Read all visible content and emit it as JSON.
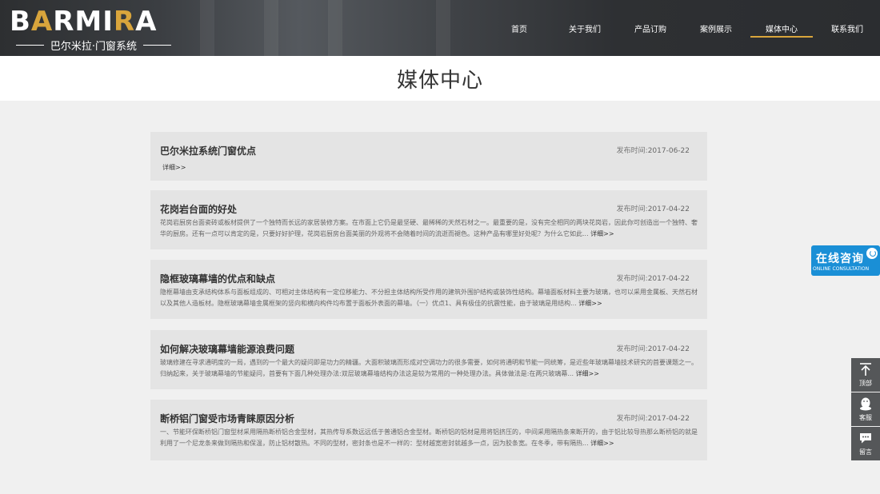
{
  "brand": {
    "logo_text_1": "B",
    "logo_accent_1": "A",
    "logo_text_2": "RMI",
    "logo_accent_2": "R",
    "logo_text_3": "A",
    "tagline": "巴尔米拉·门窗系统"
  },
  "nav": {
    "items": [
      {
        "label": "首页",
        "active": false
      },
      {
        "label": "关于我们",
        "active": false
      },
      {
        "label": "产品订购",
        "active": false
      },
      {
        "label": "案例展示",
        "active": false
      },
      {
        "label": "媒体中心",
        "active": true
      },
      {
        "label": "联系我们",
        "active": false
      }
    ]
  },
  "page_title": "媒体中心",
  "date_label": "发布时间:",
  "more_label": "详细>>",
  "articles": [
    {
      "title": "巴尔米拉系统门窗优点",
      "date": "2017-06-22",
      "excerpt": ""
    },
    {
      "title": "花岗岩台面的好处",
      "date": "2017-04-22",
      "excerpt": "花岗岩厨房台面瓷砖或板材提供了一个独特而长远的家居装修方案。在市面上它仍是最坚硬、最稀稀的天然石材之一。最重要的是，没有完全相同的两块花岗岩，因此你可创造出一个独特、奢华的厨房。还有一点可以肯定的是，只要好好护理，花岗岩厨房台面美丽的外观将不会随着时间的流逝而褪色。这种产品有哪里好处呢？为什么它如此..."
    },
    {
      "title": "隐框玻璃幕墙的优点和缺点",
      "date": "2017-04-22",
      "excerpt": "隐框幕墙由支承结构体系与面板组成的、可相对主体结构有一定位移能力、不分担主体结构所受作用的建筑外围护结构或装饰性结构。幕墙面板材料主要为玻璃，也可以采用金属板、天然石材以及其他人造板材。隐框玻璃幕墙金属框架的竖向和横向构件均布置于面板外表面的幕墙。（一）优点1、具有极佳的抗震性能，由于玻璃是用结构..."
    },
    {
      "title": "如何解决玻璃幕墙能源浪费问题",
      "date": "2017-04-22",
      "excerpt": "玻璃修建在寻求通明度的一局，遇到的一个最大的疑问即是功力的精疆。大面积玻璃而形成对空调功力的很多需要，如何将通明和节能一同统筹，是近些年玻璃幕墙技术研究的首要课题之一。归纳起来，关于玻璃幕墙的节能疑问，首要有下面几种处理办法:双层玻璃幕墙结构办法这是较为常用的一种处理办法。具体做法是:在两只玻璃幕..."
    },
    {
      "title": "断桥铝门窗受市场青睐原因分析",
      "date": "2017-04-22",
      "excerpt": "一、节能环保断桥铝门窗型材采用隔热断桥铝合金型材，其热传导系数远远低于普通铝合金型材。断桥铝的铝材是用将铝挤压的，中间采用隔热条来断开的，由于铝比较导热那么断桥铝的就是利用了一个尼龙条来做到隔热和保温，防止铝材散热。不同的型材，密封条也是不一样的：型材越宽密封就越多一点，因为胶条宽。在冬季，带有隔热..."
    }
  ],
  "consult": {
    "title": "在线咨询",
    "subtitle": "ONLINE CONSULTATION",
    "icon": "qq-icon"
  },
  "side_tools": [
    {
      "label": "顶部",
      "icon": "back-to-top-icon"
    },
    {
      "label": "客服",
      "icon": "qq-penguin-icon"
    },
    {
      "label": "留言",
      "icon": "message-icon"
    }
  ]
}
